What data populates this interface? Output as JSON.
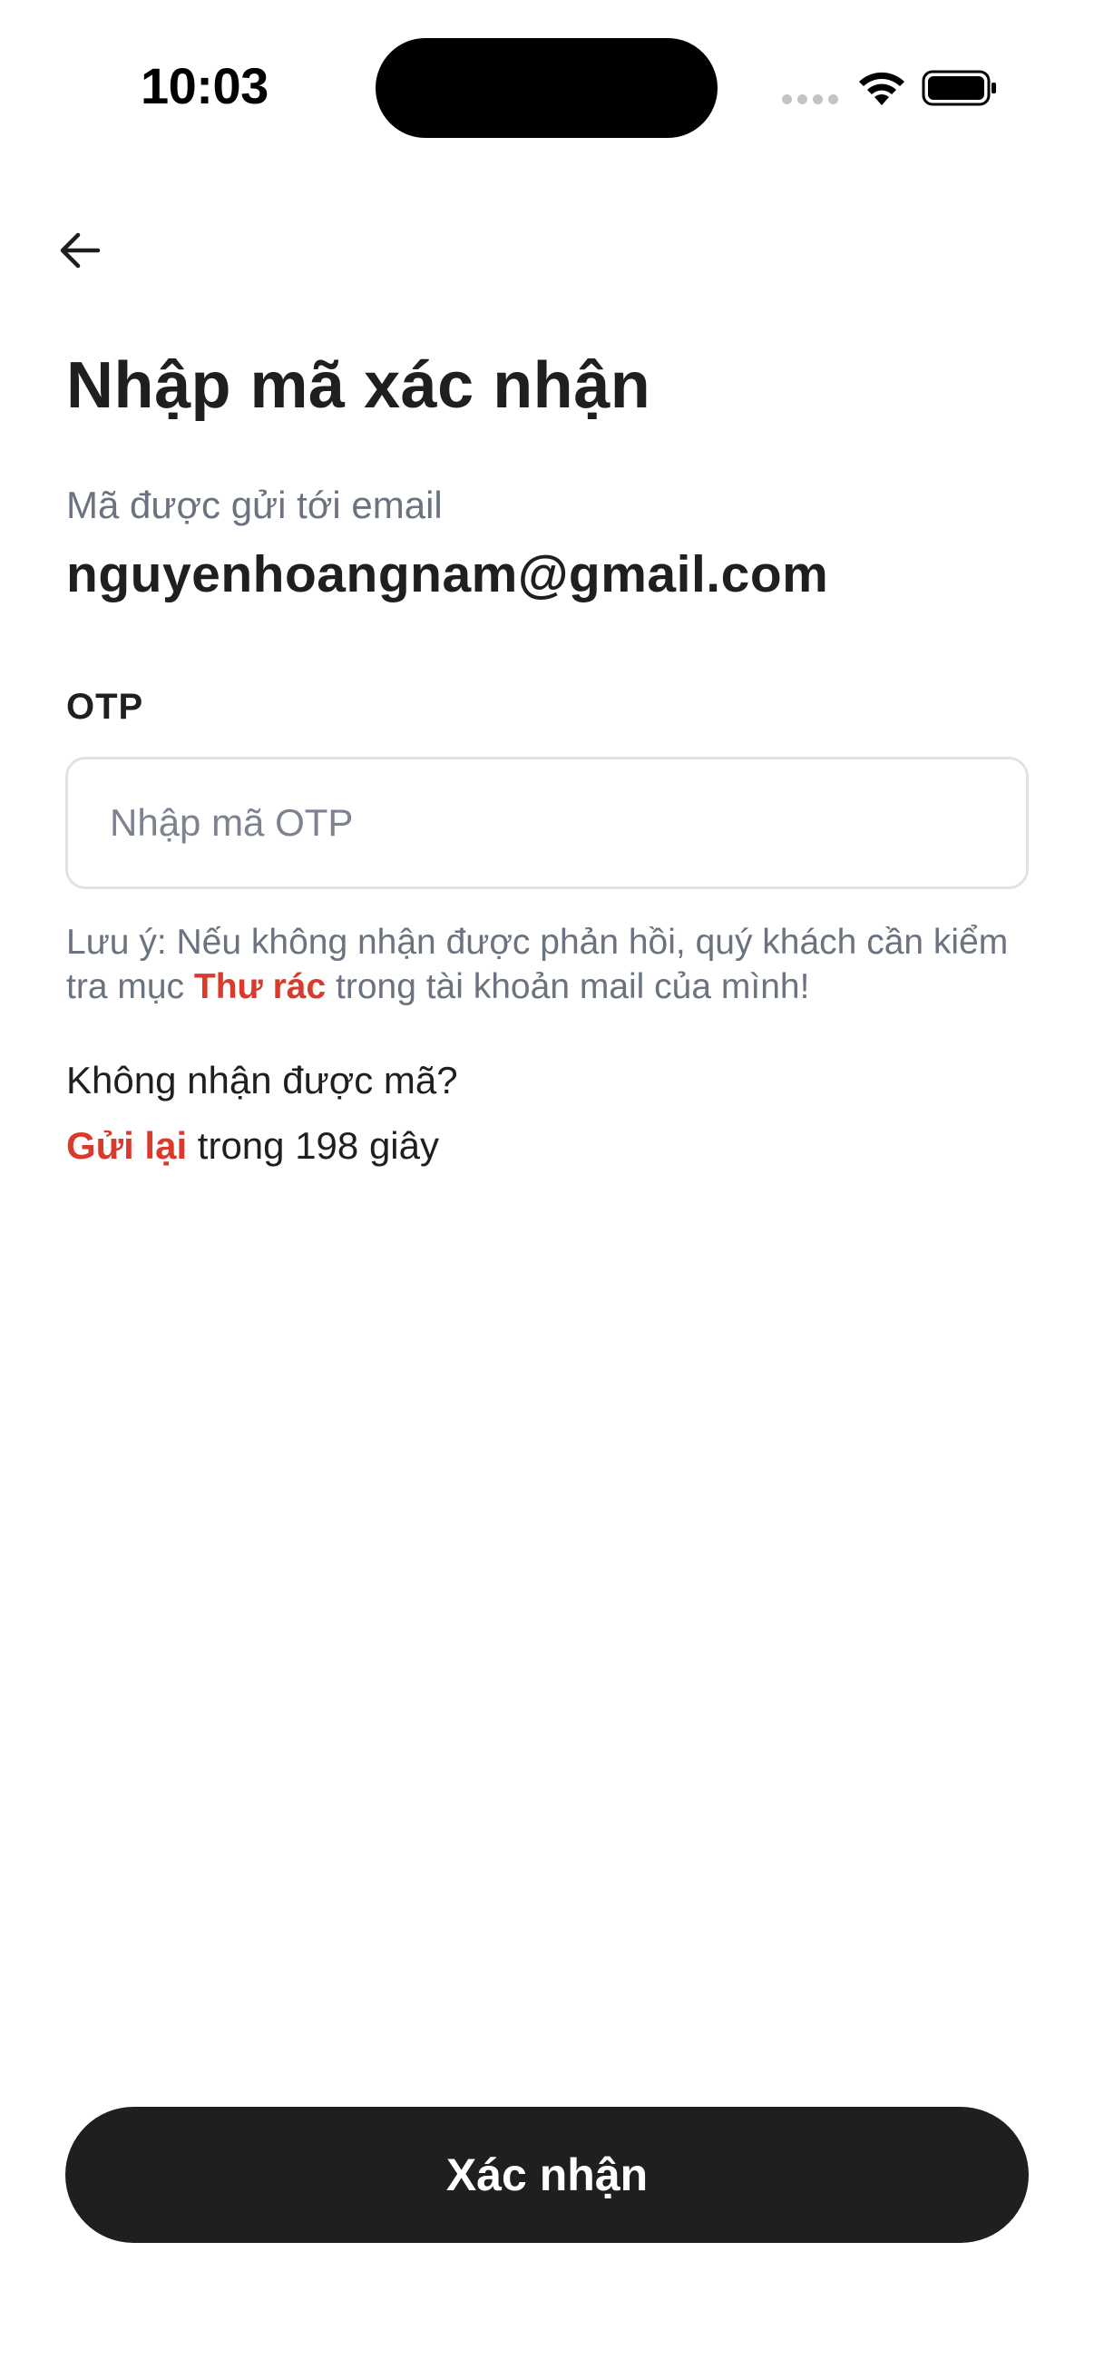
{
  "status_bar": {
    "time": "10:03",
    "icons": [
      "signal-dots-icon",
      "wifi-icon",
      "battery-icon"
    ]
  },
  "header": {
    "back_icon": "arrow-left-icon",
    "title": "Nhập mã xác nhận"
  },
  "info": {
    "subtitle": "Mã được gửi tới email",
    "email": "nguyenhoangnam@gmail.com"
  },
  "otp": {
    "label": "OTP",
    "value": "",
    "placeholder": "Nhập mã OTP"
  },
  "note": {
    "prefix": "Lưu ý: Nếu không nhận được phản hồi, quý khách cần kiểm tra mục ",
    "highlight": "Thư rác",
    "suffix": " trong tài khoản mail của mình!"
  },
  "resend": {
    "question": "Không nhận được mã?",
    "link": "Gửi lại",
    "countdown_text": " trong 198 giây"
  },
  "actions": {
    "confirm_label": "Xác nhận"
  },
  "colors": {
    "accent": "#d93a2b",
    "primary_button": "#1f1f1f",
    "muted_text": "#6b7280"
  }
}
